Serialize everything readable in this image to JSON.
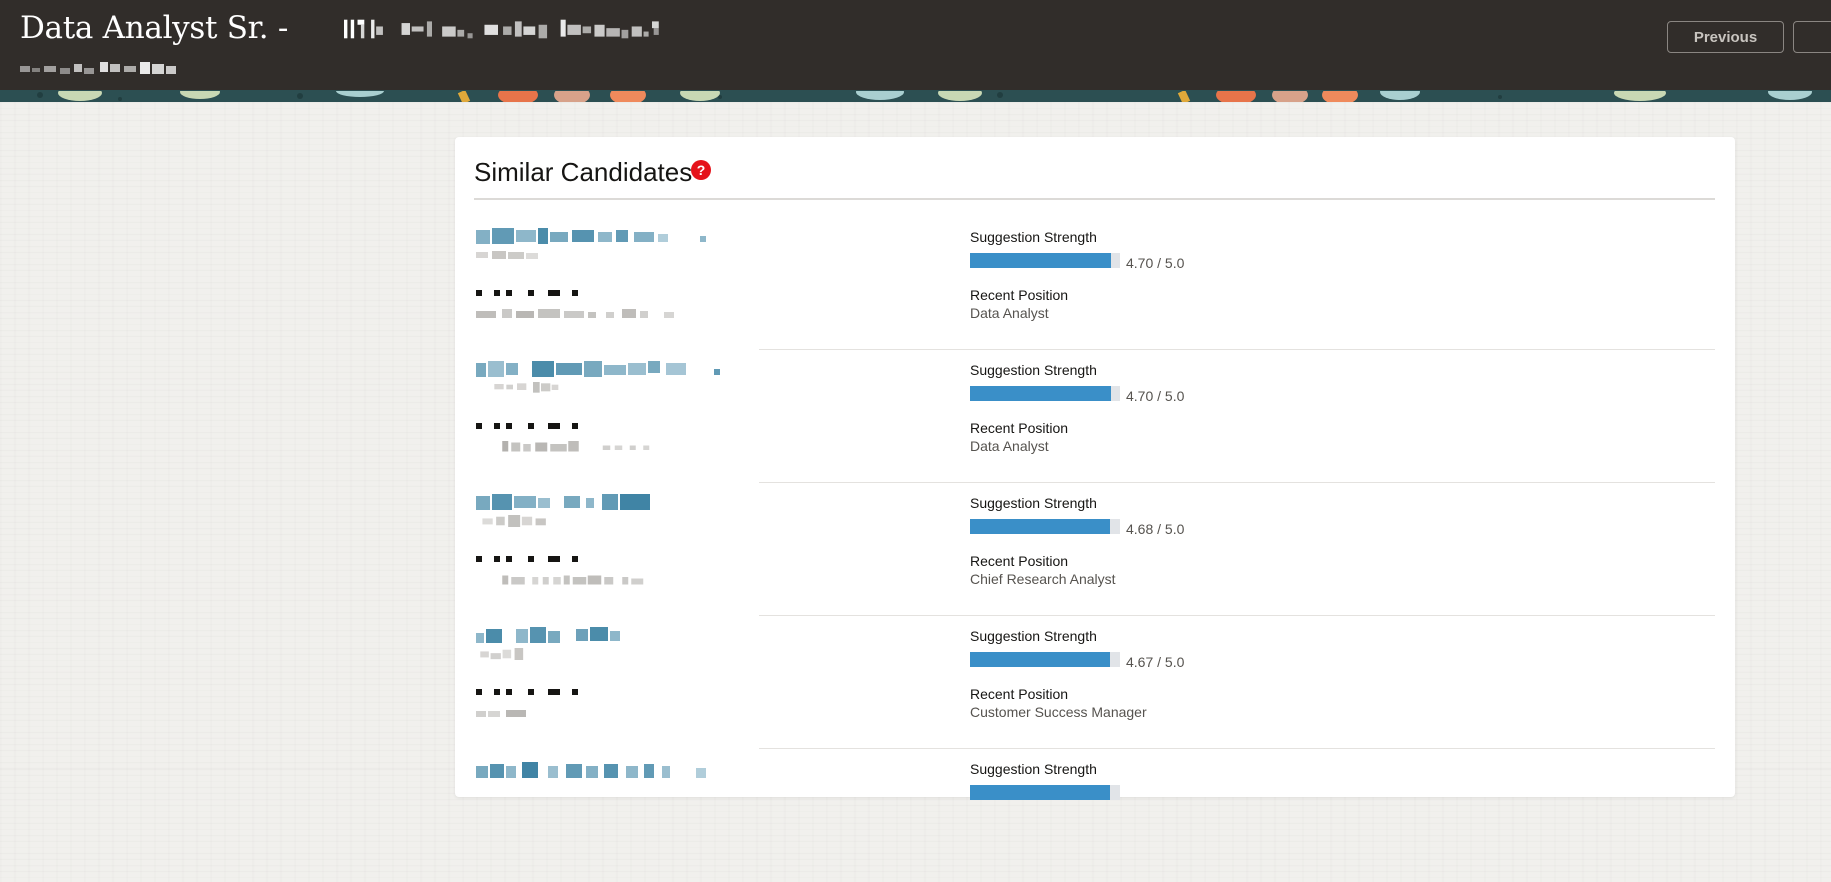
{
  "header": {
    "title": "Data Analyst Sr. -",
    "previous_label": "Previous",
    "next_label": ""
  },
  "section": {
    "title": "Similar Candidates",
    "help_icon": "?"
  },
  "candidates": [
    {
      "strength_label": "Suggestion Strength",
      "strength_fraction": 0.94,
      "score": "4.70 / 5.0",
      "position_label": "Recent Position",
      "position": "Data Analyst"
    },
    {
      "strength_label": "Suggestion Strength",
      "strength_fraction": 0.94,
      "score": "4.70 / 5.0",
      "position_label": "Recent Position",
      "position": "Data Analyst"
    },
    {
      "strength_label": "Suggestion Strength",
      "strength_fraction": 0.936,
      "score": "4.68 / 5.0",
      "position_label": "Recent Position",
      "position": "Chief Research Analyst"
    },
    {
      "strength_label": "Suggestion Strength",
      "strength_fraction": 0.934,
      "score": "4.67 / 5.0",
      "position_label": "Recent Position",
      "position": "Customer Success Manager"
    },
    {
      "strength_label": "Suggestion Strength",
      "strength_fraction": 0.93,
      "score": "",
      "position_label": "",
      "position": ""
    }
  ],
  "colors": {
    "header_bg": "#312d2a",
    "bar_fill": "#3a8fc8",
    "bar_track": "#e1e4e8",
    "help_icon": "#e5131b",
    "name_link": "#1e6f95"
  },
  "icons": {
    "help": "question-circle-icon"
  }
}
